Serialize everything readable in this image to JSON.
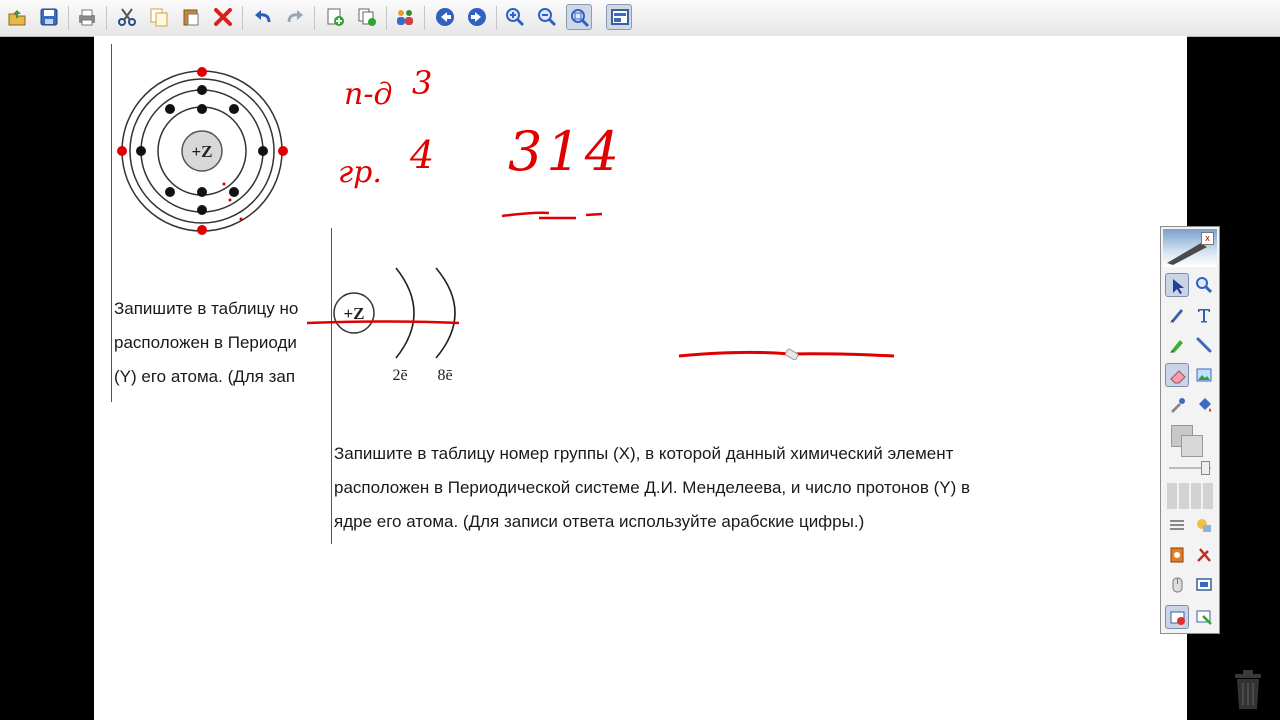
{
  "toolbar": {
    "buttons": [
      {
        "name": "open-icon"
      },
      {
        "name": "save-icon"
      },
      {
        "name": "print-icon"
      },
      {
        "name": "cut-icon"
      },
      {
        "name": "copy-icon"
      },
      {
        "name": "paste-icon"
      },
      {
        "name": "delete-icon"
      },
      {
        "name": "undo-icon"
      },
      {
        "name": "redo-icon"
      },
      {
        "name": "add-page-icon"
      },
      {
        "name": "duplicate-page-icon"
      },
      {
        "name": "users-icon"
      },
      {
        "name": "previous-page-icon"
      },
      {
        "name": "next-page-icon"
      },
      {
        "name": "zoom-in-icon"
      },
      {
        "name": "zoom-out-icon"
      },
      {
        "name": "zoom-fit-icon"
      },
      {
        "name": "screen-icon"
      }
    ]
  },
  "atom_diagram": {
    "nucleus_label": "+Z"
  },
  "shell_diagram": {
    "nucleus_label": "+Z",
    "shell1_label": "2ē",
    "shell2_label": "8ē"
  },
  "handwriting": {
    "period_label": "п-д",
    "period_value": "3",
    "group_label": "гр.",
    "group_value": "4",
    "answer": "314",
    "ink_color": "#e00000"
  },
  "question_back": {
    "lines": [
      "Запишите в таблицу но",
      "расположен в Периоди",
      "(Y) его атома. (Для зап"
    ]
  },
  "question_front": {
    "lines": [
      "Запишите в таблицу номер группы (X), в которой данный химический элемент",
      "расположен в Периодической системе Д.И. Менделеева, и число протонов (Y) в",
      "ядре его атома. (Для записи ответа используйте арабские цифры.)"
    ]
  },
  "palette": {
    "close_label": "x",
    "tools": [
      {
        "name": "select-icon"
      },
      {
        "name": "zoom-tool-icon"
      },
      {
        "name": "pen-icon"
      },
      {
        "name": "text-tool-icon"
      },
      {
        "name": "highlighter-icon"
      },
      {
        "name": "line-tool-icon"
      },
      {
        "name": "eraser-icon"
      },
      {
        "name": "image-tool-icon"
      },
      {
        "name": "eyedropper-icon"
      },
      {
        "name": "fill-icon"
      }
    ]
  }
}
